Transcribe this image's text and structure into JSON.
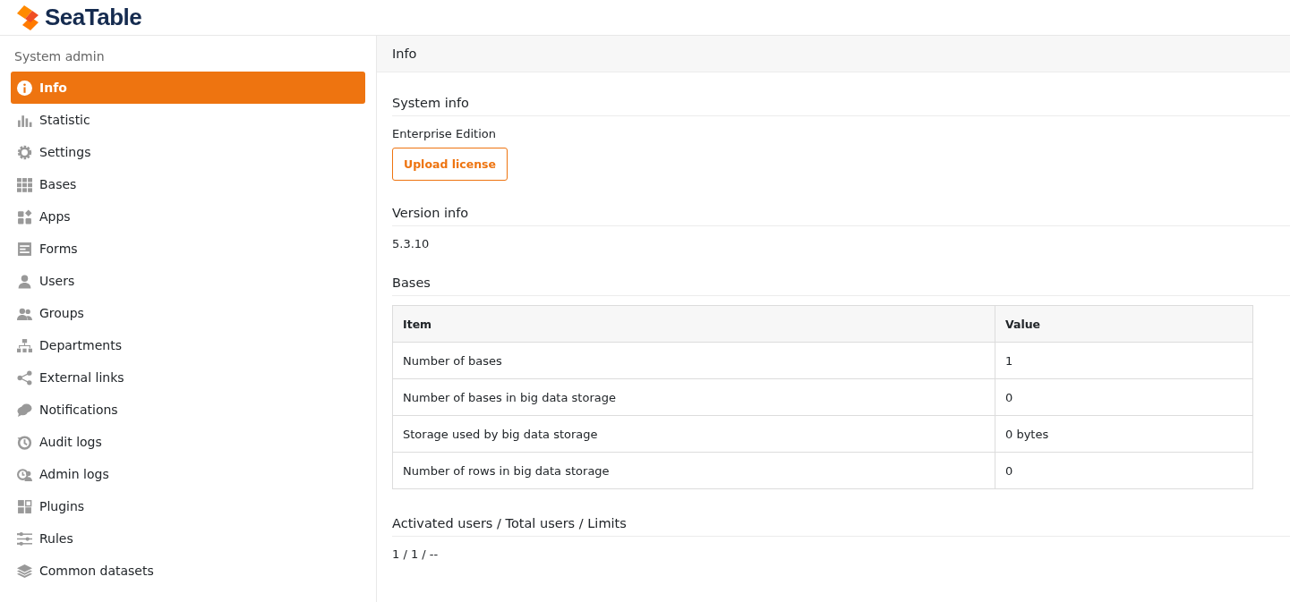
{
  "header": {
    "logo_text": "SeaTable"
  },
  "sidebar": {
    "title": "System admin",
    "items": [
      {
        "label": "Info",
        "selected": true
      },
      {
        "label": "Statistic",
        "selected": false
      },
      {
        "label": "Settings",
        "selected": false
      },
      {
        "label": "Bases",
        "selected": false
      },
      {
        "label": "Apps",
        "selected": false
      },
      {
        "label": "Forms",
        "selected": false
      },
      {
        "label": "Users",
        "selected": false
      },
      {
        "label": "Groups",
        "selected": false
      },
      {
        "label": "Departments",
        "selected": false
      },
      {
        "label": "External links",
        "selected": false
      },
      {
        "label": "Notifications",
        "selected": false
      },
      {
        "label": "Audit logs",
        "selected": false
      },
      {
        "label": "Admin logs",
        "selected": false
      },
      {
        "label": "Plugins",
        "selected": false
      },
      {
        "label": "Rules",
        "selected": false
      },
      {
        "label": "Common datasets",
        "selected": false
      }
    ]
  },
  "main": {
    "title": "Info",
    "system_info": {
      "heading": "System info",
      "edition": "Enterprise Edition",
      "button": "Upload license"
    },
    "version_info": {
      "heading": "Version info",
      "version": "5.3.10"
    },
    "bases": {
      "heading": "Bases",
      "columns": [
        "Item",
        "Value"
      ],
      "rows": [
        [
          "Number of bases",
          "1"
        ],
        [
          "Number of bases in big data storage",
          "0"
        ],
        [
          "Storage used by big data storage",
          "0 bytes"
        ],
        [
          "Number of rows in big data storage",
          "0"
        ]
      ]
    },
    "users": {
      "heading": "Activated users / Total users / Limits",
      "value": "1 / 1 / --"
    }
  }
}
